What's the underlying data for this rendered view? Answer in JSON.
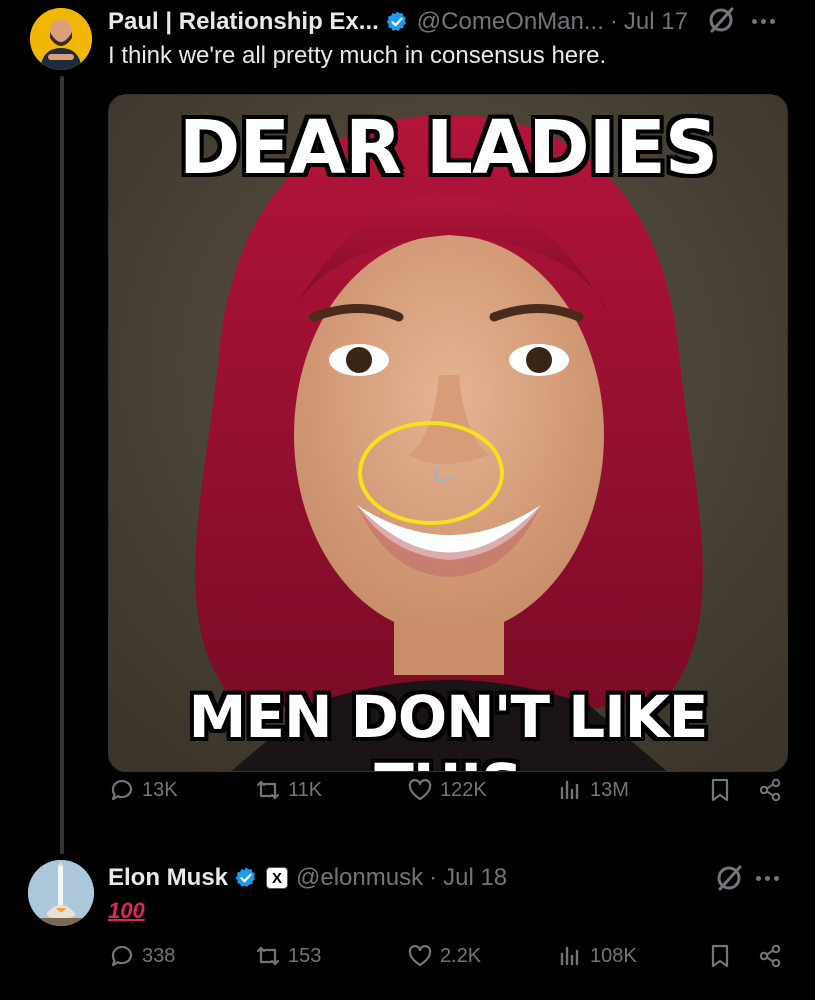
{
  "tweet": {
    "author_name": "Paul | Relationship Ex...",
    "handle": "@ComeOnMan...",
    "date": "Jul 17",
    "text": "I think we're all pretty much in consensus here.",
    "image": {
      "top_text": "DEAR LADIES",
      "bottom_text": "MEN DON'T LIKE THIS"
    },
    "stats": {
      "replies": "13K",
      "reposts": "11K",
      "likes": "122K",
      "views": "13M"
    }
  },
  "reply": {
    "author_name": "Elon Musk",
    "affiliate_badge": "X",
    "handle": "@elonmusk",
    "date": "Jul 18",
    "text": "100",
    "stats": {
      "replies": "338",
      "reposts": "153",
      "likes": "2.2K",
      "views": "108K"
    }
  },
  "colors": {
    "background": "#000000",
    "text": "#e7e9ea",
    "muted": "#71767b",
    "verified_blue": "#1d9bf0",
    "hundred_red": "#e0245e",
    "highlight_yellow": "#f7e11a"
  }
}
